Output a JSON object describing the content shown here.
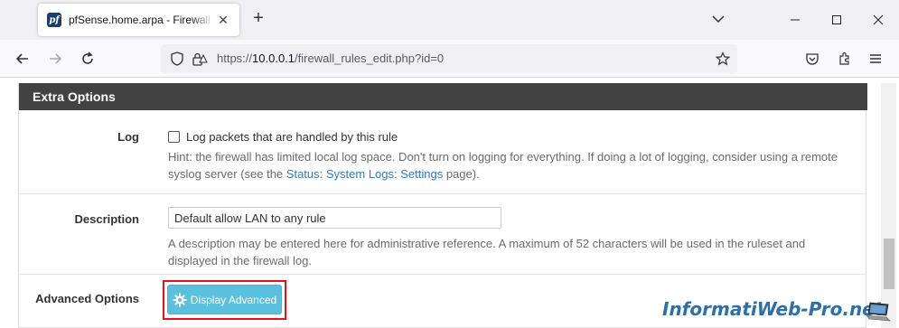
{
  "browser": {
    "tab_title": "pfSense.home.arpa - Firewall: Rules: Edit",
    "favicon_text": "pf",
    "url_prefix": "https://",
    "url_host": "10.0.0.1",
    "url_path": "/firewall_rules_edit.php?id=0"
  },
  "panel": {
    "heading": "Extra Options"
  },
  "log": {
    "label": "Log",
    "checkbox_label": "Log packets that are handled by this rule",
    "checked": false,
    "hint_part1": "Hint: the firewall has limited local log space. Don't turn on logging for everything. If doing a lot of logging, consider using a remote syslog server (see the ",
    "hint_link": "Status: System Logs: Settings",
    "hint_part2": " page)."
  },
  "description": {
    "label": "Description",
    "value": "Default allow LAN to any rule",
    "help": "A description may be entered here for administrative reference. A maximum of 52 characters will be used in the ruleset and displayed in the firewall log."
  },
  "advanced": {
    "label": "Advanced Options",
    "button_label": "Display Advanced"
  },
  "watermark": "InformatiWeb-Pro.net",
  "colors": {
    "panel_heading": "#424242",
    "button_info": "#5bc0de",
    "highlight_border": "#e0161b",
    "link": "#337ab7"
  }
}
